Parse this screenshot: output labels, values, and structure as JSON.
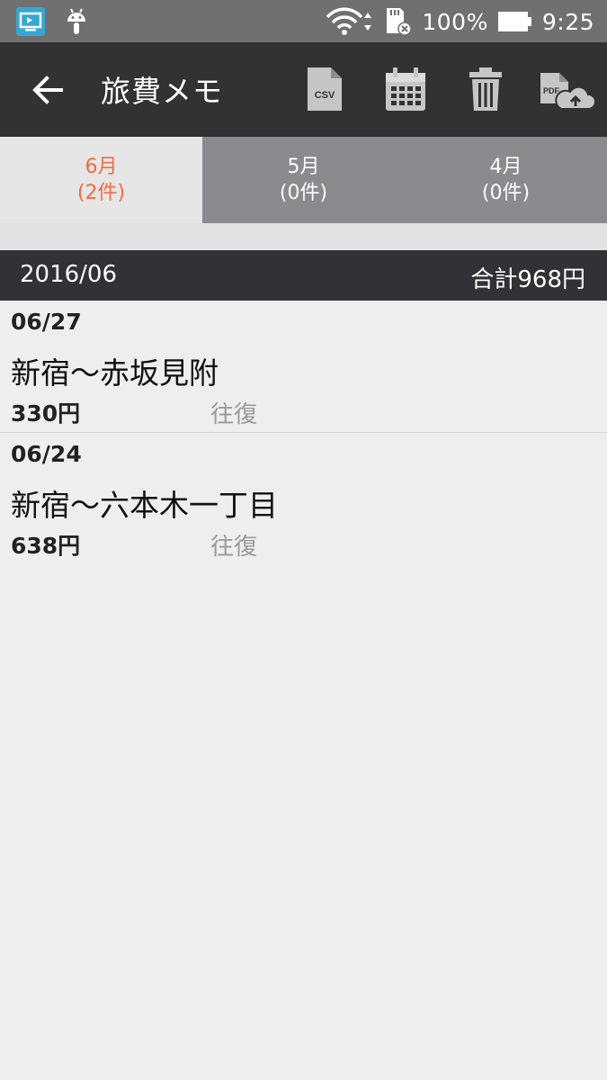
{
  "status_bar": {
    "battery": "100%",
    "time": "9:25"
  },
  "app_bar": {
    "title": "旅費メモ",
    "csv_label": "CSV",
    "pdf_label": "PDF"
  },
  "tabs": [
    {
      "month": "6月",
      "count": "(2件)",
      "active": true
    },
    {
      "month": "5月",
      "count": "(0件)",
      "active": false
    },
    {
      "month": "4月",
      "count": "(0件)",
      "active": false
    }
  ],
  "month_header": {
    "label": "2016/06",
    "total": "合計968円"
  },
  "entries": [
    {
      "date": "06/27",
      "route": "新宿〜赤坂見附",
      "amount": "330円",
      "type": "往復"
    },
    {
      "date": "06/24",
      "route": "新宿〜六本木一丁目",
      "amount": "638円",
      "type": "往復"
    }
  ],
  "colors": {
    "status_bar": "#707070",
    "app_bar": "#323232",
    "tab_inactive": "#8b8b8e",
    "tab_active_text": "#f36b3f",
    "background": "#eeeeee"
  }
}
